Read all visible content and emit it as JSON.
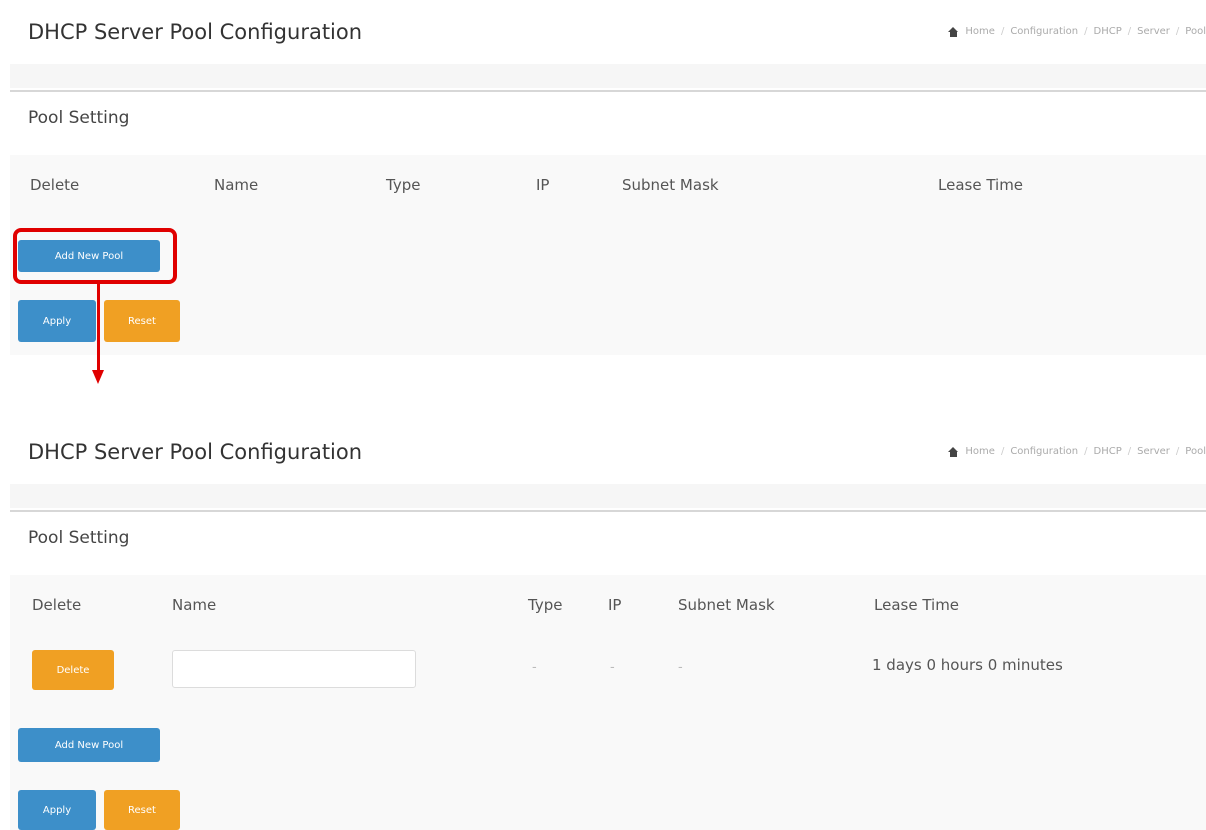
{
  "top_panel": {
    "title": "DHCP Server Pool Configuration",
    "breadcrumb": [
      "Home",
      "Configuration",
      "DHCP",
      "Server",
      "Pool"
    ],
    "section_title": "Pool Setting",
    "columns": [
      "Delete",
      "Name",
      "Type",
      "IP",
      "Subnet Mask",
      "Lease Time"
    ],
    "add_button_label": "Add New Pool",
    "apply_label": "Apply",
    "reset_label": "Reset"
  },
  "bottom_panel": {
    "title": "DHCP Server Pool Configuration",
    "breadcrumb": [
      "Home",
      "Configuration",
      "DHCP",
      "Server",
      "Pool"
    ],
    "section_title": "Pool Setting",
    "columns": [
      "Delete",
      "Name",
      "Type",
      "IP",
      "Subnet Mask",
      "Lease Time"
    ],
    "row": {
      "delete_label": "Delete",
      "name_value": "",
      "type": "-",
      "ip": "-",
      "subnet_mask": "-",
      "lease_time": "1 days 0 hours 0 minutes"
    },
    "add_button_label": "Add New Pool",
    "apply_label": "Apply",
    "reset_label": "Reset"
  },
  "colors": {
    "primary_button": "#3d8fc9",
    "warning_button": "#f0a023",
    "annotation": "#e00000"
  },
  "icons": {
    "breadcrumb_home": "home-icon",
    "annotation_arrow": "arrow-down-icon"
  }
}
